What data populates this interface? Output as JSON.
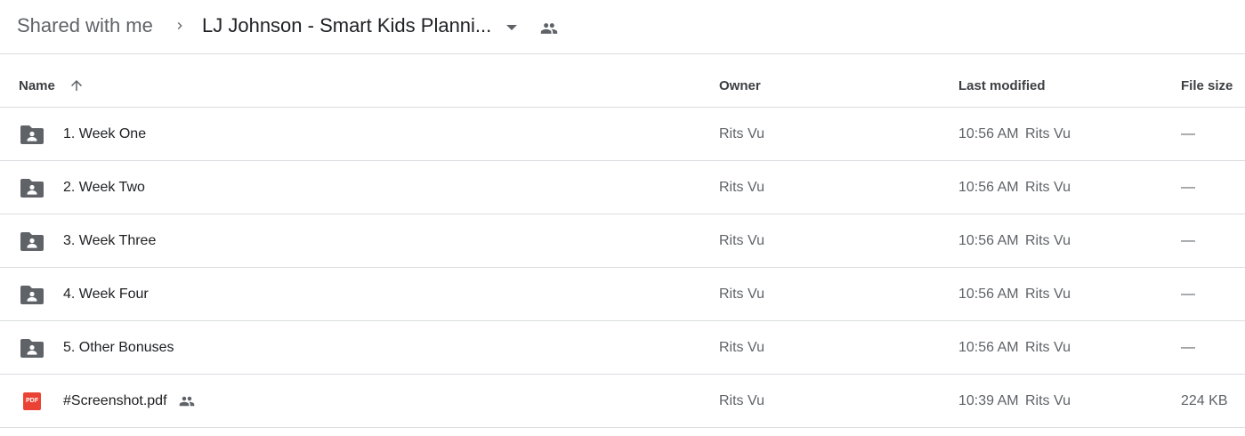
{
  "breadcrumb": {
    "root": "Shared with me",
    "current": "LJ Johnson - Smart Kids Planni..."
  },
  "columns": {
    "name": "Name",
    "owner": "Owner",
    "last_modified": "Last modified",
    "file_size": "File size"
  },
  "files": [
    {
      "name": "1. Week One",
      "type": "shared-folder",
      "owner": "Rits Vu",
      "modified_time": "10:56 AM",
      "modified_by": "Rits Vu",
      "size": "—"
    },
    {
      "name": "2. Week Two",
      "type": "shared-folder",
      "owner": "Rits Vu",
      "modified_time": "10:56 AM",
      "modified_by": "Rits Vu",
      "size": "—"
    },
    {
      "name": "3. Week Three",
      "type": "shared-folder",
      "owner": "Rits Vu",
      "modified_time": "10:56 AM",
      "modified_by": "Rits Vu",
      "size": "—"
    },
    {
      "name": "4. Week Four",
      "type": "shared-folder",
      "owner": "Rits Vu",
      "modified_time": "10:56 AM",
      "modified_by": "Rits Vu",
      "size": "—"
    },
    {
      "name": "5. Other Bonuses",
      "type": "shared-folder",
      "owner": "Rits Vu",
      "modified_time": "10:56 AM",
      "modified_by": "Rits Vu",
      "size": "—"
    },
    {
      "name": "#Screenshot.pdf",
      "type": "pdf",
      "icon_text": "PDF",
      "owner": "Rits Vu",
      "modified_time": "10:39 AM",
      "modified_by": "Rits Vu",
      "size": "224 KB",
      "shared": true
    }
  ],
  "colors": {
    "folder_icon": "#5f6368",
    "pdf_icon": "#ea4335",
    "divider": "#dadce0"
  }
}
